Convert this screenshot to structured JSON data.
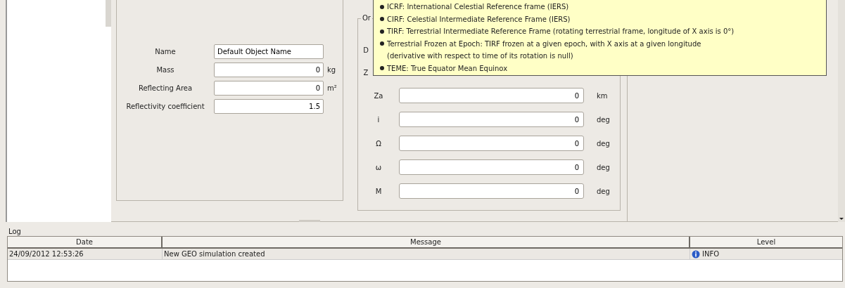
{
  "object_properties": {
    "fields": [
      {
        "label": "Name",
        "value": "Default Object Name",
        "kind": "text"
      },
      {
        "label": "Mass",
        "value": "0",
        "unit": "kg",
        "kind": "number"
      },
      {
        "label": "Reflecting Area",
        "value": "0",
        "unit": "m²",
        "kind": "number"
      },
      {
        "label": "Reflectivity coefficient",
        "value": "1.5",
        "kind": "number"
      }
    ]
  },
  "orbit": {
    "title": "Or",
    "covered_labels": [
      "D",
      "Z"
    ],
    "fields": [
      {
        "label": "Za",
        "value": "0",
        "unit": "km"
      },
      {
        "label": "i",
        "value": "0",
        "unit": "deg"
      },
      {
        "label": "Ω",
        "value": "0",
        "unit": "deg"
      },
      {
        "label": "ω",
        "value": "0",
        "unit": "deg"
      },
      {
        "label": "M",
        "value": "0",
        "unit": "deg"
      }
    ]
  },
  "tooltip": {
    "lines": [
      {
        "kind": "bullet",
        "text": "ICRF: International Celestial Reference frame (IERS)"
      },
      {
        "kind": "bullet",
        "text": "CIRF: Celestial Intermediate Reference Frame (IERS)"
      },
      {
        "kind": "bullet",
        "text": "TIRF: Terrestrial Intermediate Reference Frame (rotating terrestrial frame, longitude of X axis is 0°)"
      },
      {
        "kind": "bullet",
        "text": "Terrestrial Frozen at Epoch: TIRF frozen at a given epoch, with X axis at a given longitude"
      },
      {
        "kind": "continuation",
        "text": "(derivative with respect to time of its rotation is null)"
      },
      {
        "kind": "bullet",
        "text": "TEME: True Equator Mean Equinox"
      }
    ]
  },
  "log": {
    "title": "Log",
    "columns": [
      "Date",
      "Message",
      "Level"
    ],
    "rows": [
      {
        "date": "24/09/2012 12:53:26",
        "message": "New GEO simulation created",
        "level": "INFO"
      }
    ]
  }
}
